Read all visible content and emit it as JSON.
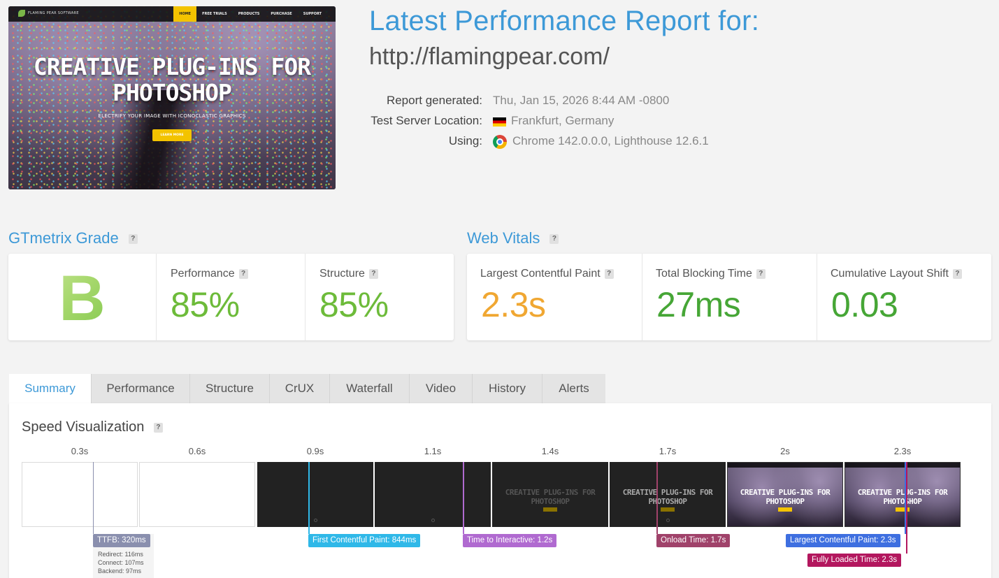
{
  "thumbnail": {
    "brand": "FLAMING PEAR SOFTWARE",
    "nav": [
      "HOME",
      "FREE TRIALS",
      "PRODUCTS",
      "PURCHASE",
      "SUPPORT"
    ],
    "headline_line1": "CREATIVE PLUG-INS FOR",
    "headline_line2": "PHOTOSHOP",
    "subtitle": "ELECTRIFY YOUR IMAGE WITH ICONOCLASTIC GRAPHICS",
    "button": "LEARN MORE"
  },
  "header": {
    "title": "Latest Performance Report for:",
    "url": "http://flamingpear.com/",
    "report_generated_label": "Report generated:",
    "report_generated_value": "Thu, Jan 15, 2026 8:44 AM -0800",
    "location_label": "Test Server Location:",
    "location_value": "Frankfurt, Germany",
    "using_label": "Using:",
    "using_value": "Chrome 142.0.0.0, Lighthouse 12.6.1"
  },
  "grade": {
    "title": "GTmetrix Grade",
    "letter": "B",
    "performance_label": "Performance",
    "performance_value": "85%",
    "structure_label": "Structure",
    "structure_value": "85%"
  },
  "vitals": {
    "title": "Web Vitals",
    "lcp_label": "Largest Contentful Paint",
    "lcp_value": "2.3s",
    "tbt_label": "Total Blocking Time",
    "tbt_value": "27ms",
    "cls_label": "Cumulative Layout Shift",
    "cls_value": "0.03"
  },
  "colors": {
    "accent": "#3d99d7",
    "good": "#46a636",
    "light_good": "#6dbb3a",
    "average": "#f0a732"
  },
  "tabs": [
    "Summary",
    "Performance",
    "Structure",
    "CrUX",
    "Waterfall",
    "Video",
    "History",
    "Alerts"
  ],
  "active_tab": "Summary",
  "speed": {
    "title": "Speed Visualization",
    "frame_times": [
      "0.3s",
      "0.6s",
      "0.9s",
      "1.1s",
      "1.4s",
      "1.7s",
      "2s",
      "2.3s"
    ],
    "frame_headline_1": "CREATIVE PLUG-INS FOR",
    "frame_headline_2": "PHOTOSHOP",
    "ttfb": "TTFB: 320ms",
    "redirect": "Redirect: 116ms",
    "connect": "Connect: 107ms",
    "backend": "Backend: 97ms",
    "fcp": "First Contentful Paint: 844ms",
    "tti": "Time to Interactive: 1.2s",
    "onload": "Onload Time: 1.7s",
    "lcp": "Largest Contentful Paint: 2.3s",
    "fully_loaded": "Fully Loaded Time: 2.3s"
  }
}
